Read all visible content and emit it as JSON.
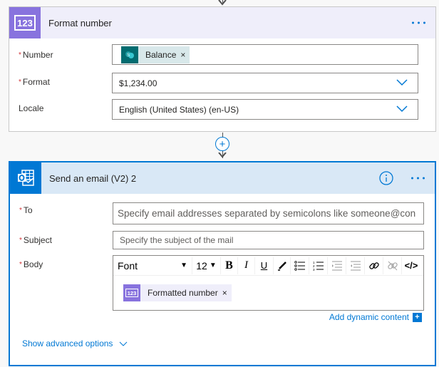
{
  "format_number_card": {
    "title": "Format number",
    "icon": "number-123-icon",
    "accent_color": "#8873de",
    "header_bg": "#efeefa",
    "more_icon": "ellipsis-icon",
    "fields": {
      "number": {
        "label": "Number",
        "required": true,
        "token": {
          "label": "Balance",
          "icon": "sharepoint-icon",
          "remove_icon": "close-icon"
        }
      },
      "format": {
        "label": "Format",
        "required": true,
        "value": "$1,234.00",
        "dropdown_icon": "chevron-down-icon"
      },
      "locale": {
        "label": "Locale",
        "required": false,
        "value": "English (United States) (en-US)",
        "dropdown_icon": "chevron-down-icon"
      }
    }
  },
  "connector": {
    "add_icon": "plus-circle-icon",
    "arrow_icon": "arrow-down-icon"
  },
  "email_card": {
    "title": "Send an email (V2) 2",
    "icon": "outlook-icon",
    "accent_color": "#0078d4",
    "header_bg": "#d9e8f6",
    "info_icon": "info-icon",
    "more_icon": "ellipsis-icon",
    "fields": {
      "to": {
        "label": "To",
        "required": true,
        "placeholder": "Specify email addresses separated by semicolons like someone@con"
      },
      "subject": {
        "label": "Subject",
        "required": true,
        "placeholder": "Specify the subject of the mail"
      },
      "body": {
        "label": "Body",
        "required": true,
        "toolbar": {
          "font": "Font",
          "size": "12",
          "bold": "B",
          "italic": "I",
          "underline": "U",
          "code": "</>"
        },
        "token": {
          "label": "Formatted number",
          "icon": "number-123-icon",
          "remove_icon": "close-icon"
        }
      }
    },
    "add_dynamic_content": "Add dynamic content",
    "show_advanced": "Show advanced options"
  },
  "required_marker": "*"
}
